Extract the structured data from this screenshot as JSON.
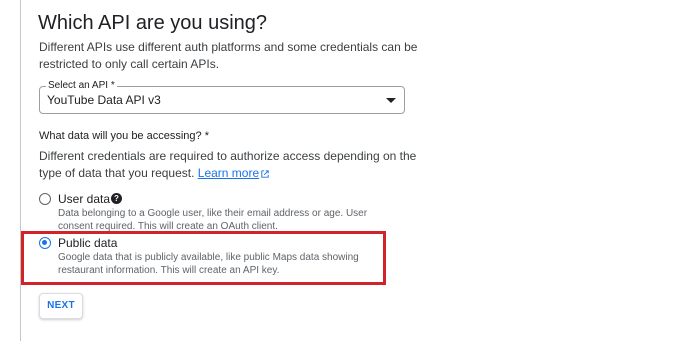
{
  "section": {
    "title": "Which API are you using?",
    "description": "Different APIs use different auth platforms and some credentials can be restricted to only call certain APIs."
  },
  "api_select": {
    "label": "Select an API *",
    "value": "YouTube Data API v3",
    "arrow_icon": "arrow-drop-down-icon"
  },
  "data_access": {
    "question": "What data will you be accessing? *",
    "description": "Different credentials are required to authorize access depending on the type of data that you request.",
    "learn_more": "Learn more",
    "learn_more_icon": "external-link-icon"
  },
  "options": [
    {
      "label": "User data",
      "description": "Data belonging to a Google user, like their email address or age. User consent required. This will create an OAuth client.",
      "selected": false,
      "help_icon": "help-icon"
    },
    {
      "label": "Public data",
      "description": "Google data that is publicly available, like public Maps data showing restaurant information. This will create an API key.",
      "selected": true
    }
  ],
  "next_button": {
    "label": "NEXT"
  },
  "colors": {
    "accent": "#1a73e8",
    "highlight": "#d2232a",
    "text": "#202124",
    "secondary_text": "#5f6368"
  }
}
